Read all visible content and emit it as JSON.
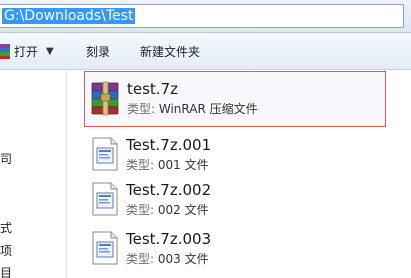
{
  "address": {
    "path": "G:\\Downloads\\Test"
  },
  "toolbar": {
    "open_label": "打开",
    "open_arrow": "▼",
    "burn_label": "刻录",
    "new_folder_label": "新建文件夹"
  },
  "nav": {
    "items": [
      "司",
      "式",
      "项",
      "目"
    ]
  },
  "files": [
    {
      "name": "test.7z",
      "type_label": "类型: ",
      "type_value": "WinRAR 压缩文件",
      "icon": "winrar-archive-icon"
    },
    {
      "name": "Test.7z.001",
      "type_label": "类型: ",
      "type_value": "001 文件",
      "icon": "generic-file-icon"
    },
    {
      "name": "Test.7z.002",
      "type_label": "类型: ",
      "type_value": "002 文件",
      "icon": "generic-file-icon"
    },
    {
      "name": "Test.7z.003",
      "type_label": "类型: ",
      "type_value": "003 文件",
      "icon": "generic-file-icon"
    }
  ]
}
